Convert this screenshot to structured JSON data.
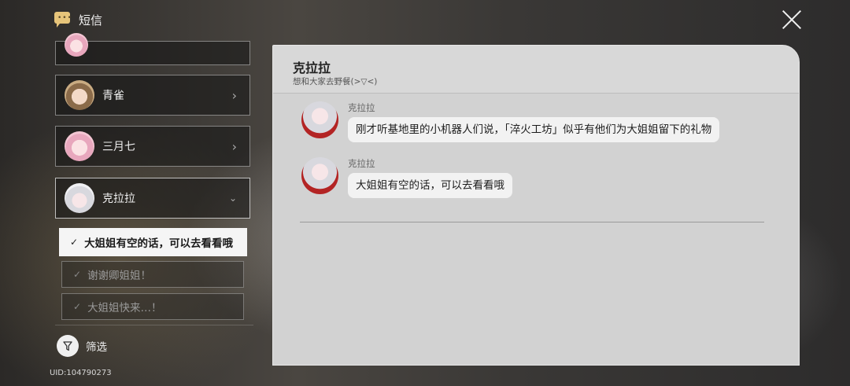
{
  "header": {
    "title": "短信",
    "icon": "message-bubble-icon"
  },
  "contacts": [
    {
      "name": "青雀"
    },
    {
      "name": "三月七"
    },
    {
      "name": "克拉拉"
    }
  ],
  "reply_options": [
    {
      "text": "大姐姐有空的话，可以去看看哦",
      "selected": true
    },
    {
      "text": "谢谢卿姐姐！",
      "selected": false
    },
    {
      "text": "大姐姐快来…！",
      "selected": false
    }
  ],
  "filter": {
    "label": "筛选"
  },
  "uid": "UID:104790273",
  "chat": {
    "name": "克拉拉",
    "status": "想和大家去野餐(>▽<)",
    "messages": [
      {
        "sender": "克拉拉",
        "text": "刚才听基地里的小机器人们说，「淬火工坊」似乎有他们为大姐姐留下的礼物"
      },
      {
        "sender": "克拉拉",
        "text": "大姐姐有空的话，可以去看看哦"
      }
    ]
  },
  "colors": {
    "panel_bg": "#d2d2d2",
    "bubble_bg": "#f2f2f2",
    "icon_accent": "#e6c47a"
  }
}
